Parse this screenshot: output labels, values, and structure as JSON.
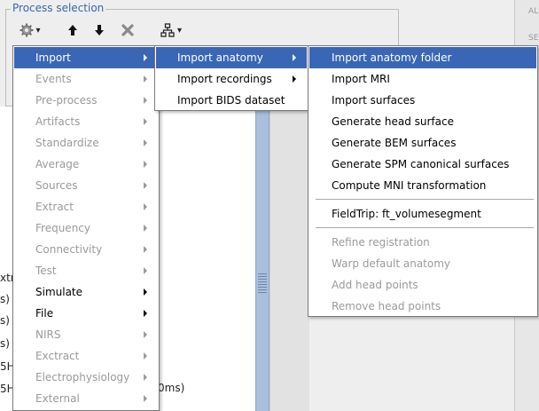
{
  "panel": {
    "title": "Process selection",
    "right_top": "ALL",
    "right_sub": "SEL"
  },
  "toolbar": {
    "gear_caret": "▾",
    "up": "🡑",
    "down": "🡓",
    "remove": "✖",
    "tree_caret": "▾"
  },
  "tree_fragments": [
    "xtr",
    "s)",
    "s)",
    "s)",
    "5H",
    "5H",
    "0ms)"
  ],
  "menu1": {
    "items": [
      {
        "label": "Import",
        "state": "sel",
        "sub": true
      },
      {
        "label": "Events",
        "state": "dis",
        "sub": true
      },
      {
        "label": "Pre-process",
        "state": "dis",
        "sub": true
      },
      {
        "label": "Artifacts",
        "state": "dis",
        "sub": true
      },
      {
        "label": "Standardize",
        "state": "dis",
        "sub": true
      },
      {
        "label": "Average",
        "state": "dis",
        "sub": true
      },
      {
        "label": "Sources",
        "state": "dis",
        "sub": true
      },
      {
        "label": "Extract",
        "state": "dis",
        "sub": true
      },
      {
        "label": "Frequency",
        "state": "dis",
        "sub": true
      },
      {
        "label": "Connectivity",
        "state": "dis",
        "sub": true
      },
      {
        "label": "Test",
        "state": "dis",
        "sub": true
      },
      {
        "label": "Simulate",
        "state": "en",
        "sub": true
      },
      {
        "label": "File",
        "state": "en",
        "sub": true
      },
      {
        "label": "NIRS",
        "state": "dis",
        "sub": true
      },
      {
        "label": "Exctract",
        "state": "dis",
        "sub": true
      },
      {
        "label": "Electrophysiology",
        "state": "dis",
        "sub": true
      },
      {
        "label": "External",
        "state": "dis",
        "sub": true
      }
    ]
  },
  "menu2": {
    "items": [
      {
        "label": "Import anatomy",
        "state": "sel",
        "sub": true
      },
      {
        "label": "Import recordings",
        "state": "en",
        "sub": true
      },
      {
        "label": "Import BIDS dataset",
        "state": "en",
        "sub": false
      }
    ]
  },
  "menu3": {
    "items": [
      {
        "label": "Import anatomy folder",
        "state": "sel"
      },
      {
        "label": "Import MRI",
        "state": "en"
      },
      {
        "label": "Import surfaces",
        "state": "en"
      },
      {
        "label": "Generate head surface",
        "state": "en"
      },
      {
        "label": "Generate BEM surfaces",
        "state": "en"
      },
      {
        "label": "Generate SPM canonical surfaces",
        "state": "en"
      },
      {
        "label": "Compute MNI transformation",
        "state": "en"
      },
      {
        "type": "separator"
      },
      {
        "label": "FieldTrip: ft_volumesegment",
        "state": "en"
      },
      {
        "type": "separator"
      },
      {
        "label": "Refine registration",
        "state": "dis"
      },
      {
        "label": "Warp default anatomy",
        "state": "dis"
      },
      {
        "label": "Add head points",
        "state": "dis"
      },
      {
        "label": "Remove head points",
        "state": "dis"
      }
    ]
  }
}
